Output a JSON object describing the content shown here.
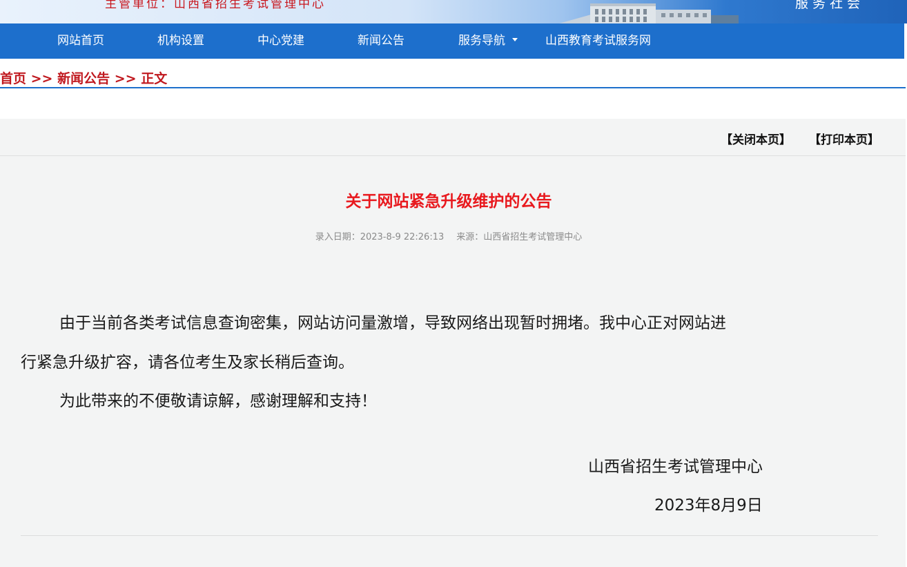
{
  "banner": {
    "sponsor": "主管单位：山西省招生考试管理中心",
    "motto": "服务社会"
  },
  "nav": {
    "items": [
      {
        "label": "网站首页"
      },
      {
        "label": "机构设置"
      },
      {
        "label": "中心党建"
      },
      {
        "label": "新闻公告"
      },
      {
        "label": "服务导航"
      },
      {
        "label": "山西教育考试服务网"
      }
    ]
  },
  "breadcrumb": {
    "home": "首页",
    "separator": ">>",
    "section": "新闻公告",
    "current": "正文"
  },
  "tools": {
    "close": "【关闭本页】",
    "print": "【打印本页】"
  },
  "article": {
    "title": "关于网站紧急升级维护的公告",
    "date_label": "录入日期：",
    "date": "2023-8-9 22:26:13",
    "source_label": "来源：",
    "source": "山西省招生考试管理中心",
    "para1_line1": "由于当前各类考试信息查询密集，网站访问量激增，导致网络出现暂时拥堵。我中心正对网站进",
    "para1_line2": "行紧急升级扩容，请各位考生及家长稍后查询。",
    "para2": "为此带来的不便敬请谅解，感谢理解和支持！",
    "signature_org": "山西省招生考试管理中心",
    "signature_date": "2023年8月9日"
  },
  "colors": {
    "nav_bg": "#1d6fcc",
    "title_red": "#e8191e",
    "crumb_red": "#c0181e",
    "panel_bg": "#f3f4f4"
  }
}
